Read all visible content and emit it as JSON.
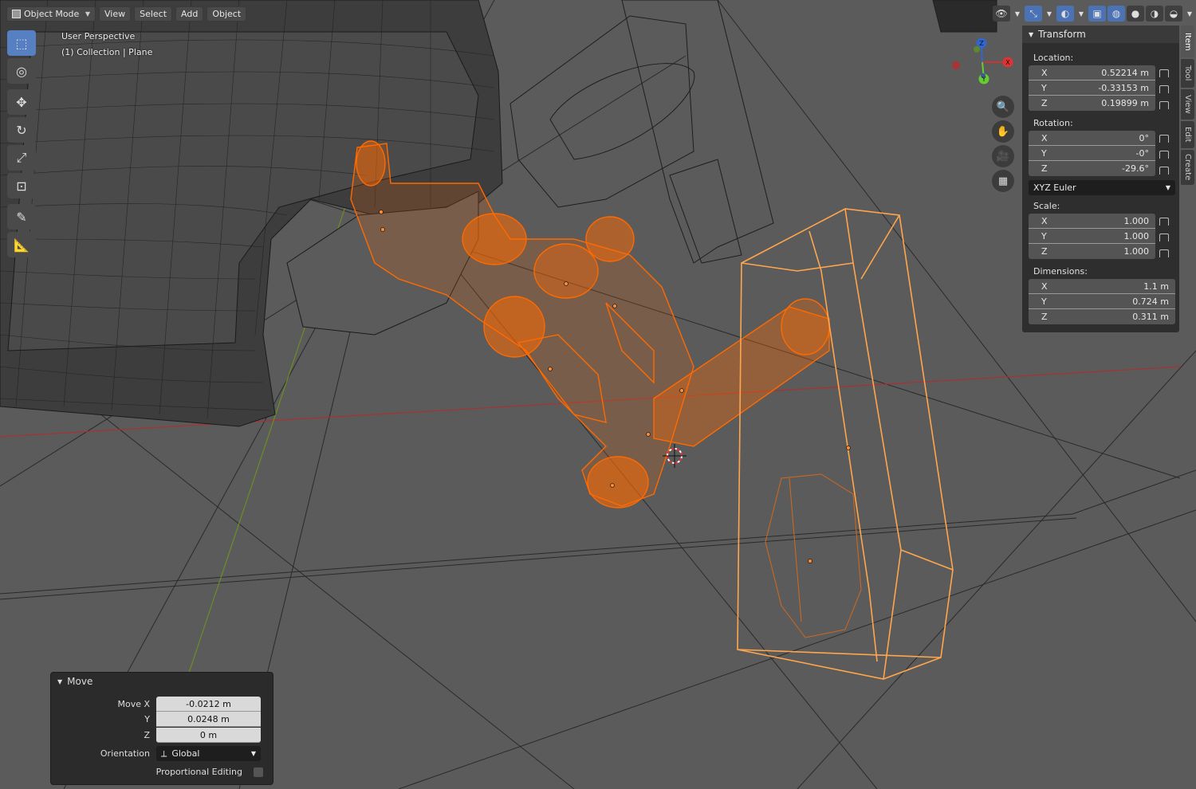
{
  "header": {
    "mode": "Object Mode",
    "menus": [
      "View",
      "Select",
      "Add",
      "Object"
    ]
  },
  "viewport": {
    "perspective_label": "User Perspective",
    "collection_label": "(1) Collection | Plane"
  },
  "gizmo": {
    "axis_x": "X",
    "axis_y": "Y",
    "axis_z": "Z"
  },
  "npanel": {
    "title": "Transform",
    "location": {
      "label": "Location:",
      "x": {
        "axis": "X",
        "value": "0.52214 m"
      },
      "y": {
        "axis": "Y",
        "value": "-0.33153 m"
      },
      "z": {
        "axis": "Z",
        "value": "0.19899 m"
      }
    },
    "rotation": {
      "label": "Rotation:",
      "x": {
        "axis": "X",
        "value": "0°"
      },
      "y": {
        "axis": "Y",
        "value": "-0°"
      },
      "z": {
        "axis": "Z",
        "value": "-29.6°"
      }
    },
    "rotation_mode": "XYZ Euler",
    "scale": {
      "label": "Scale:",
      "x": {
        "axis": "X",
        "value": "1.000"
      },
      "y": {
        "axis": "Y",
        "value": "1.000"
      },
      "z": {
        "axis": "Z",
        "value": "1.000"
      }
    },
    "dimensions": {
      "label": "Dimensions:",
      "x": {
        "axis": "X",
        "value": "1.1 m"
      },
      "y": {
        "axis": "Y",
        "value": "0.724 m"
      },
      "z": {
        "axis": "Z",
        "value": "0.311 m"
      }
    }
  },
  "sidetabs": [
    "Item",
    "Tool",
    "View",
    "Edit",
    "Create"
  ],
  "move_panel": {
    "title": "Move",
    "move_x_label": "Move X",
    "move_x": "-0.0212 m",
    "y_label": "Y",
    "move_y": "0.0248 m",
    "z_label": "Z",
    "move_z": "0 m",
    "orientation_label": "Orientation",
    "orientation": "Global",
    "proportional_label": "Proportional Editing"
  },
  "colors": {
    "viewport": "#5b5b5b",
    "selected_orange": "#ff6a00",
    "active_orange": "#ffa64d",
    "axis_x_red": "#c43030",
    "axis_y_green": "#6b8e23",
    "active_tool_blue": "#5680c2"
  }
}
